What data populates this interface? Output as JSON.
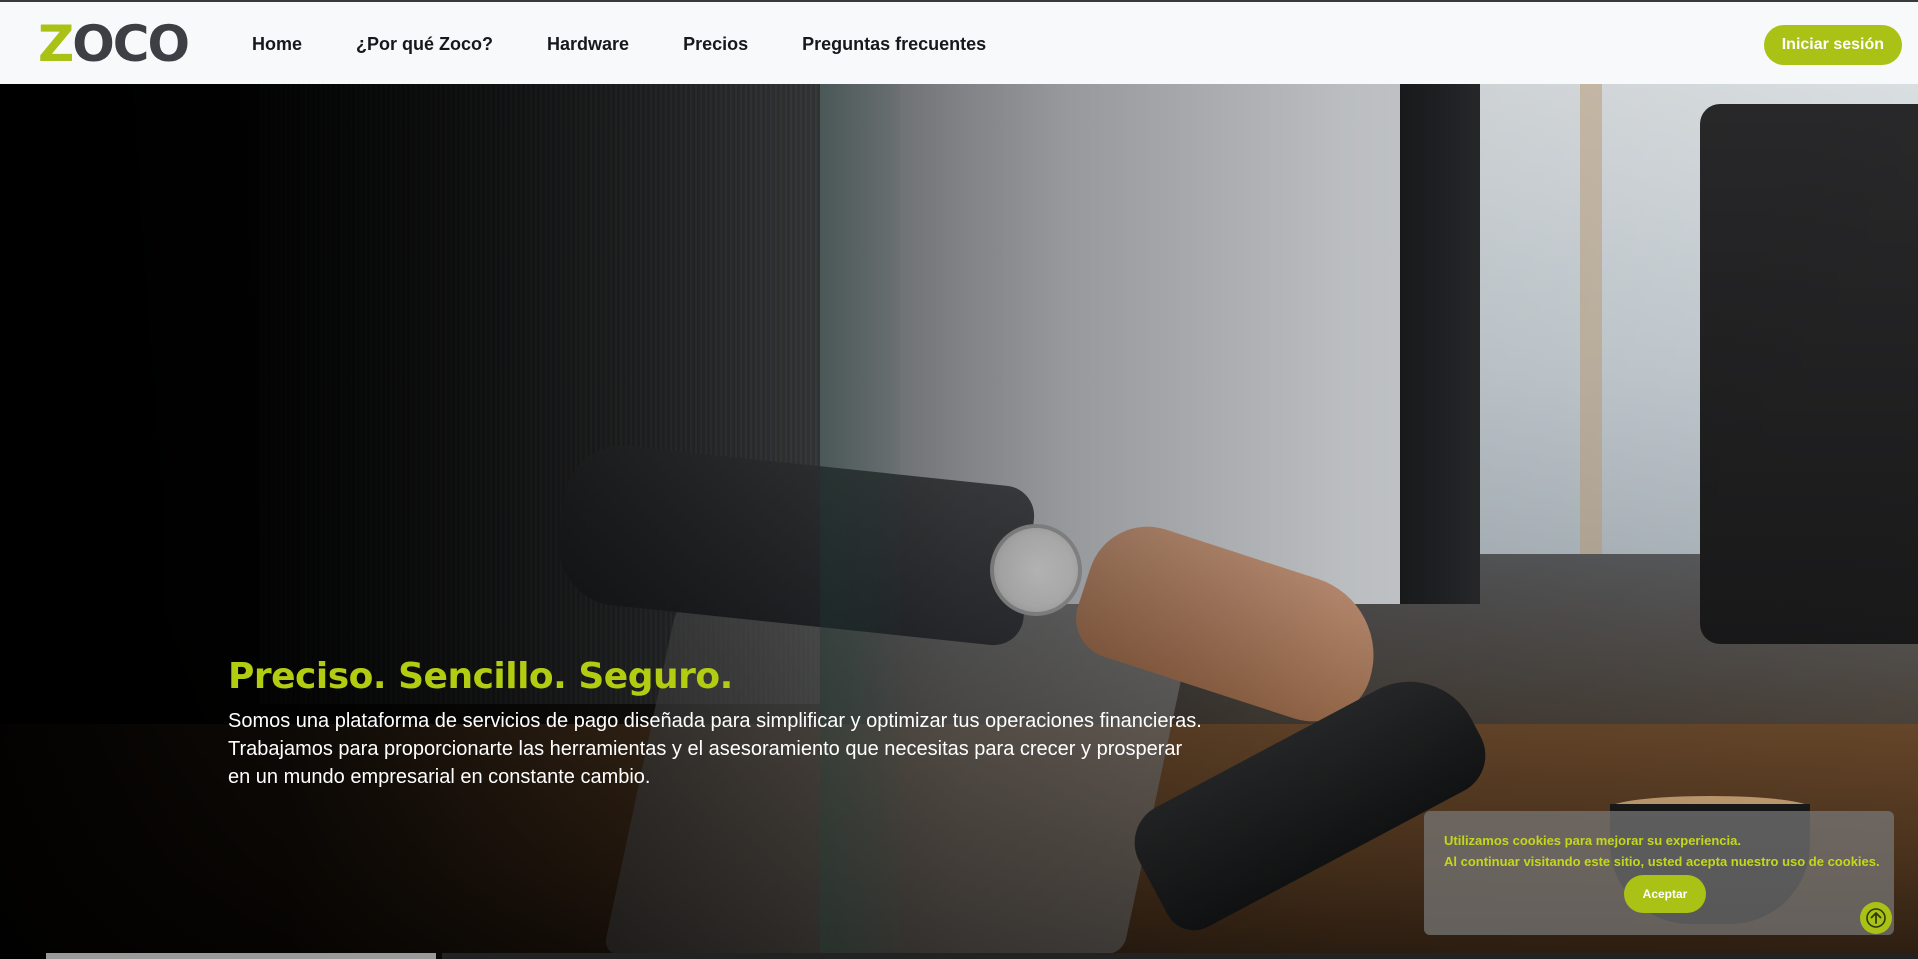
{
  "brand": {
    "logo_first": "Z",
    "logo_rest": "OCO",
    "accent_color": "#a9c215"
  },
  "nav": {
    "items": [
      {
        "label": "Home"
      },
      {
        "label": "¿Por qué Zoco?"
      },
      {
        "label": "Hardware"
      },
      {
        "label": "Precios"
      },
      {
        "label": "Preguntas frecuentes"
      }
    ],
    "login_label": "Iniciar sesión"
  },
  "hero": {
    "title": "Preciso. Sencillo. Seguro.",
    "description": "Somos una plataforma de servicios de pago diseñada para simplificar y optimizar tus operaciones financieras. Trabajamos para proporcionarte las herramientas y el asesoramiento que necesitas para crecer y prosperar en un mundo empresarial en constante cambio."
  },
  "cookie_banner": {
    "line1": "Utilizamos cookies para mejorar su experiencia.",
    "line2": "Al continuar visitando este sitio, usted acepta nuestro uso de cookies.",
    "accept_label": "Aceptar"
  },
  "icons": {
    "scroll_top": "arrow-up-circle-icon"
  }
}
